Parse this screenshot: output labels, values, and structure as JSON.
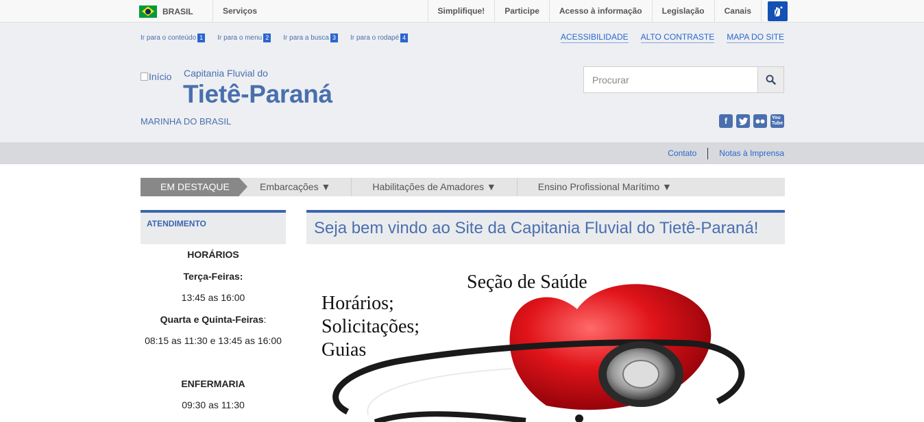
{
  "gov_bar": {
    "country": "BRASIL",
    "services": "Serviços",
    "links": [
      "Simplifique!",
      "Participe",
      "Acesso à informação",
      "Legislação",
      "Canais"
    ]
  },
  "accessibility": {
    "skip_links": [
      {
        "label": "Ir para o conteúdo",
        "num": "1"
      },
      {
        "label": "Ir para o menu",
        "num": "2"
      },
      {
        "label": "Ir para a busca",
        "num": "3"
      },
      {
        "label": "Ir para o rodapé",
        "num": "4"
      }
    ],
    "right_links": [
      "ACESSIBILIDADE",
      "ALTO CONTRASTE",
      "MAPA DO SITE"
    ]
  },
  "header": {
    "logo_alt": "Início",
    "subtitle": "Capitania Fluvial do",
    "title": "Tietê-Paraná",
    "org": "MARINHA DO BRASIL",
    "search_placeholder": "Procurar"
  },
  "social": [
    "facebook-icon",
    "twitter-icon",
    "flickr-icon",
    "youtube-icon"
  ],
  "subbar": {
    "links": [
      "Contato",
      "Notas à Imprensa"
    ]
  },
  "menu": {
    "highlight": "EM DESTAQUE",
    "items": [
      "Embarcações ▼",
      "Habilitações de Amadores ▼",
      "Ensino Profissional Marítimo ▼"
    ]
  },
  "sidebar": {
    "heading": "ATENDIMENTO",
    "horarios_title": "HORÁRIOS",
    "day1": "Terça-Feiras:",
    "time1": "13:45 as 16:00",
    "day2": "Quarta e Quinta-Feiras",
    "day2_suffix": ":",
    "time2": "08:15 as 11:30 e 13:45 as 16:00",
    "enfermaria_title": "ENFERMARIA",
    "time3": "09:30 as 11:30"
  },
  "main": {
    "heading": "Seja bem vindo ao Site da Capitania Fluvial do Tietê-Paraná!",
    "banner_title": "Seção de Saúde",
    "banner_lines": [
      "Horários;",
      "Solicitações;",
      "Guias"
    ]
  },
  "colors": {
    "brand_blue": "#4a6fae",
    "accent_blue": "#3a64b3",
    "heart_red": "#e0141a"
  }
}
